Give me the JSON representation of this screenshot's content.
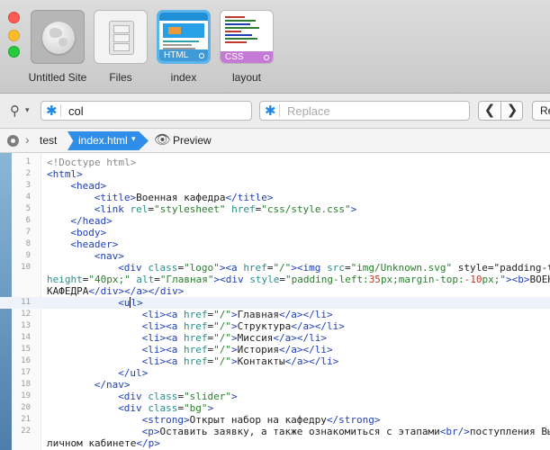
{
  "window": {
    "traffic_lights": [
      "close",
      "minimize",
      "maximize"
    ]
  },
  "files_strip": {
    "tiles": [
      {
        "caption": "Untitled Site",
        "icon": "globe-icon"
      },
      {
        "caption": "Files",
        "icon": "file-cabinet-icon"
      },
      {
        "caption": "index",
        "badge": "HTML",
        "selected": true
      },
      {
        "caption": "layout",
        "badge": "CSS"
      }
    ]
  },
  "search": {
    "find_value": "col",
    "replace_placeholder": "Replace",
    "prev_symbol": "❮",
    "next_symbol": "❯",
    "replace_button_label": "Re"
  },
  "breadcrumb": {
    "items": [
      "test",
      "index.html"
    ],
    "preview_label": "Preview"
  },
  "editor": {
    "current_line": 11,
    "lines": [
      {
        "num": "1",
        "text": "<!Doctype html>"
      },
      {
        "num": "2",
        "text": "<html>"
      },
      {
        "num": "3",
        "text": "<head>"
      },
      {
        "num": "4",
        "text": "<title>Военная кафедра</title>"
      },
      {
        "num": "5",
        "text": "<link rel=\"stylesheet\" href=\"css/style.css\">"
      },
      {
        "num": "6",
        "text": "</head>"
      },
      {
        "num": "7",
        "text": "<body>"
      },
      {
        "num": "8",
        "text": "<header>"
      },
      {
        "num": "9",
        "text": "<nav>"
      },
      {
        "num": "10",
        "text": "<div class=\"logo\"><a href=\"/\"><img src=\"img/Unknown.svg\" style=\"padding-t",
        "wrap1": "height=\"40px;\" alt=\"Главная\"><div style=\"padding-left:35px;margin-top:-10px;\"><b>ВОЕН",
        "wrap2": "КАФЕДРА</div></a></div>"
      },
      {
        "num": "11",
        "text": "<ul>"
      },
      {
        "num": "12",
        "text": "<li><a href=\"/\">Главная</a></li>"
      },
      {
        "num": "13",
        "text": "<li><a href=\"/\">Структура</a></li>"
      },
      {
        "num": "14",
        "text": "<li><a href=\"/\">Миссия</a></li>"
      },
      {
        "num": "15",
        "text": "<li><a href=\"/\">История</a></li>"
      },
      {
        "num": "16",
        "text": "<li><a href=\"/\">Контакты</a></li>"
      },
      {
        "num": "17",
        "text": "</ul>"
      },
      {
        "num": "18",
        "text": "</nav>"
      },
      {
        "num": "19",
        "text": "<div class=\"slider\">"
      },
      {
        "num": "20",
        "text": "<div class=\"bg\">"
      },
      {
        "num": "21",
        "text": "<strong>Открыт набор на кафедру</strong>"
      },
      {
        "num": "22",
        "text": "<p>Оставить заявку, а также ознакомиться с этапами<br/>поступления Вы",
        "wrap1": "личном кабинете</p>"
      }
    ]
  },
  "colors": {
    "accent_blue": "#2f8ee9",
    "html_badge": "#3f9ad7",
    "css_badge": "#c57ad6",
    "tag": "#1f3fb8",
    "attr": "#2a8e8a",
    "value": "#2a7d2e"
  }
}
